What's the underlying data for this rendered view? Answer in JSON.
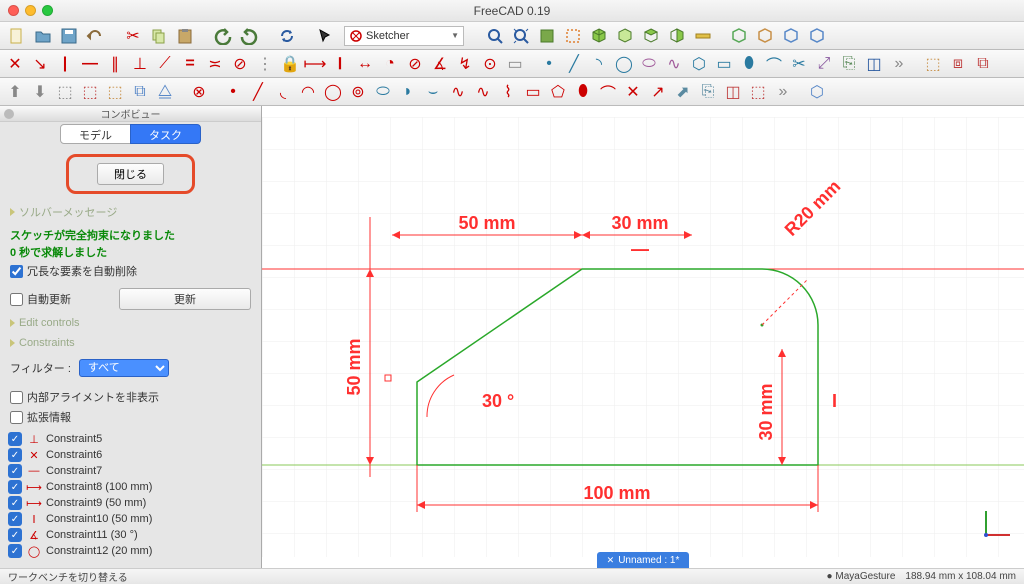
{
  "window": {
    "title": "FreeCAD 0.19"
  },
  "workbench": {
    "selected": "Sketcher"
  },
  "panel": {
    "header": "コンボビュー",
    "tabs": {
      "model": "モデル",
      "task": "タスク"
    },
    "close": "閉じる",
    "solver_section": "ソルバーメッセージ",
    "solver_msg1": "スケッチが完全拘束になりました",
    "solver_msg2": "0 秒で求解しました",
    "auto_delete": "冗長な要素を自動削除",
    "auto_update": "自動更新",
    "update_btn": "更新",
    "edit_controls": "Edit controls",
    "constraints_section": "Constraints",
    "filter_label": "フィルター :",
    "filter_value": "すべて",
    "hide_align": "内部アライメントを非表示",
    "ext_info": "拡張情報",
    "constraints": [
      {
        "name": "Constraint5",
        "icon": "⊥"
      },
      {
        "name": "Constraint6",
        "icon": "✕"
      },
      {
        "name": "Constraint7",
        "icon": "—"
      },
      {
        "name": "Constraint8 (100 mm)",
        "icon": "⟼"
      },
      {
        "name": "Constraint9 (50 mm)",
        "icon": "⟼"
      },
      {
        "name": "Constraint10 (50 mm)",
        "icon": "Ⅰ"
      },
      {
        "name": "Constraint11 (30 °)",
        "icon": "∡"
      },
      {
        "name": "Constraint12 (20 mm)",
        "icon": "◯"
      }
    ]
  },
  "drawing": {
    "dim_top1": "50 mm",
    "dim_top2": "30 mm",
    "dim_left": "50 mm",
    "dim_angle": "30 °",
    "dim_radius": "R20 mm",
    "dim_right": "30 mm",
    "dim_bottom": "100 mm"
  },
  "doc_tab": {
    "label": "Unnamed : 1*",
    "close": "✕"
  },
  "status": {
    "left": "ワークベンチを切り替える",
    "nav": "MayaGesture",
    "coords": "188.94 mm x 108.04 mm"
  },
  "chart_data": {
    "type": "diagram",
    "description": "2D sketch: horizontal base line 100 mm, left vertical rise 50 mm from a point 30° off-vertical at start, top horizontal 50 mm then 30 mm before a R20 fillet arc, right vertical 30 mm down to base. Fully constrained."
  }
}
